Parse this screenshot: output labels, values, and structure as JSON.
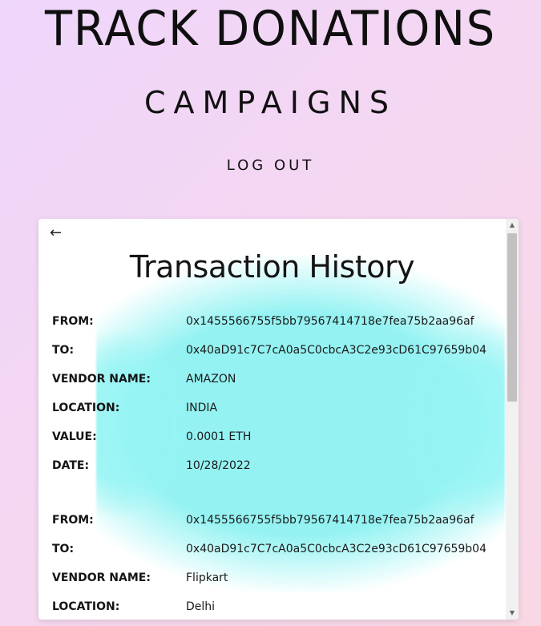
{
  "header": {
    "title": "TRACK DONATIONS",
    "campaigns": "CAMPAIGNS",
    "logout": "LOG OUT"
  },
  "card": {
    "title": "Transaction History",
    "labels": {
      "from": "FROM:",
      "to": "TO:",
      "vendor": "VENDOR NAME:",
      "location": "LOCATION:",
      "value": "VALUE:",
      "date": "DATE:"
    },
    "transactions": [
      {
        "from": "0x1455566755f5bb79567414718e7fea75b2aa96af",
        "to": "0x40aD91c7C7cA0a5C0cbcA3C2e93cD61C97659b04",
        "vendor": "AMAZON",
        "location": "INDIA",
        "value": "0.0001 ETH",
        "date": "10/28/2022"
      },
      {
        "from": "0x1455566755f5bb79567414718e7fea75b2aa96af",
        "to": "0x40aD91c7C7cA0a5C0cbcA3C2e93cD61C97659b04",
        "vendor": "Flipkart",
        "location": "Delhi"
      }
    ]
  },
  "icons": {
    "back": "←",
    "scroll_up": "▲",
    "scroll_down": "▼"
  }
}
